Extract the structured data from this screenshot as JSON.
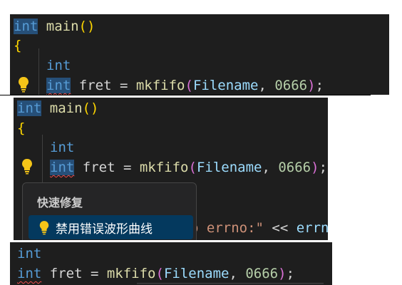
{
  "panel1": {
    "kw_int": "int",
    "main_name": "main",
    "paren_open": "(",
    "paren_close": ")",
    "brace": "{",
    "line3_kw": "int",
    "line4_kw": "int",
    "line4_mid": " fret = ",
    "fn_name": "mkfifo",
    "p_open": "(",
    "arg1": "Filename",
    "comma": ", ",
    "arg2": "0666",
    "p_close": ")",
    "semi": ";"
  },
  "panel2": {
    "kw_int": "int",
    "main_name": "main",
    "paren_open": "(",
    "paren_close": ")",
    "brace": "{",
    "line3_kw": "int",
    "line4_kw": "int",
    "line4_mid": " fret = ",
    "fn_name": "mkfifo",
    "p_open": "(",
    "arg1": "Filename",
    "comma": ", ",
    "arg2": "0666",
    "p_close": ")",
    "semi": ";",
    "partial_str": "o errno:\"",
    "partial_op": " << ",
    "partial_tail": "errn"
  },
  "quickfix": {
    "title": "快速修复",
    "item_label": "禁用错误波形曲线"
  },
  "panel3": {
    "line1_kw": "int",
    "line2_kw": "int",
    "line2_mid": " fret = ",
    "fn_name": "mkfifo",
    "p_open": "(",
    "arg1": "Filename",
    "comma": ", ",
    "arg2": "0666",
    "p_close": ")",
    "semi": ";"
  },
  "colors": {
    "editor_bg": "#1e1e1e",
    "keyword": "#569cd6",
    "function": "#dcdcaa",
    "bracket_gold": "#ffd700",
    "bracket_purple": "#da70d6",
    "parameter": "#9cdcfe",
    "number": "#b5cea8",
    "lightbulb": "#f5c518",
    "selection": "#04395e"
  }
}
